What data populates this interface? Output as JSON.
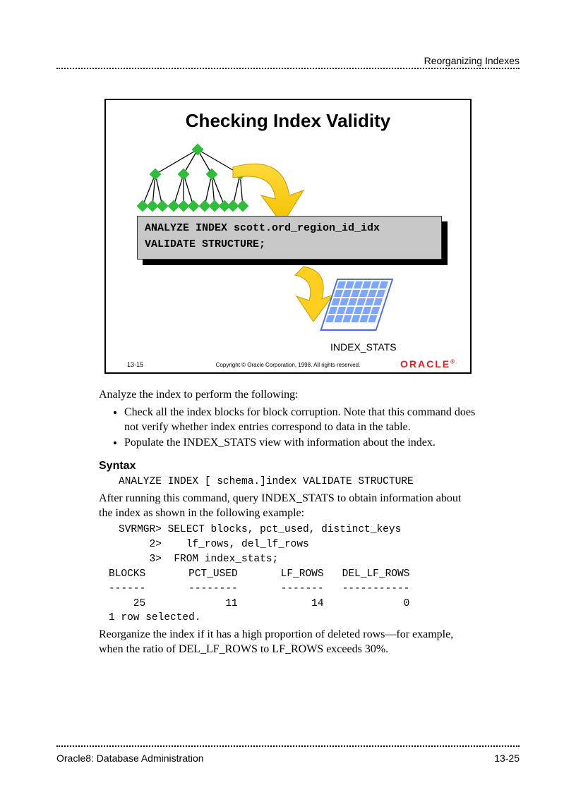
{
  "header": {
    "right": "Reorganizing Indexes"
  },
  "footer": {
    "left": "Oracle8: Database Administration",
    "right": "13-25"
  },
  "slide": {
    "title": "Checking Index Validity",
    "code_line1": "ANALYZE INDEX scott.ord_region_id_idx",
    "code_line2": "VALIDATE STRUCTURE;",
    "grid_label": "INDEX_STATS",
    "footnum": "13-15",
    "copyright": "Copyright © Oracle Corporation, 1998. All rights reserved.",
    "logo": "ORACLE"
  },
  "body": {
    "intro": "Analyze the index to perform the following:",
    "bullets": [
      "Check all the index blocks for block corruption. Note that this command does not verify whether index entries correspond to data in the table.",
      "Populate the INDEX_STATS view with information about the index."
    ],
    "syntax_heading": "Syntax",
    "syntax_line": "ANALYZE INDEX [ schema.]index VALIDATE STRUCTURE",
    "after_syntax": "After running this command, query INDEX_STATS to obtain information about the index as shown in the following example:",
    "example_lines": [
      "SVRMGR> SELECT blocks, pct_used, distinct_keys",
      "     2>    lf_rows, del_lf_rows",
      "     3>  FROM index_stats;",
      "BLOCKS       PCT_USED       LF_ROWS   DEL_LF_ROWS",
      "------       --------       -------   -----------",
      "    25             11            14             0",
      "1 row selected."
    ],
    "closing": "Reorganize the index if it has a high proportion of deleted rows—for example, when the ratio of DEL_LF_ROWS to LF_ROWS exceeds 30%."
  }
}
